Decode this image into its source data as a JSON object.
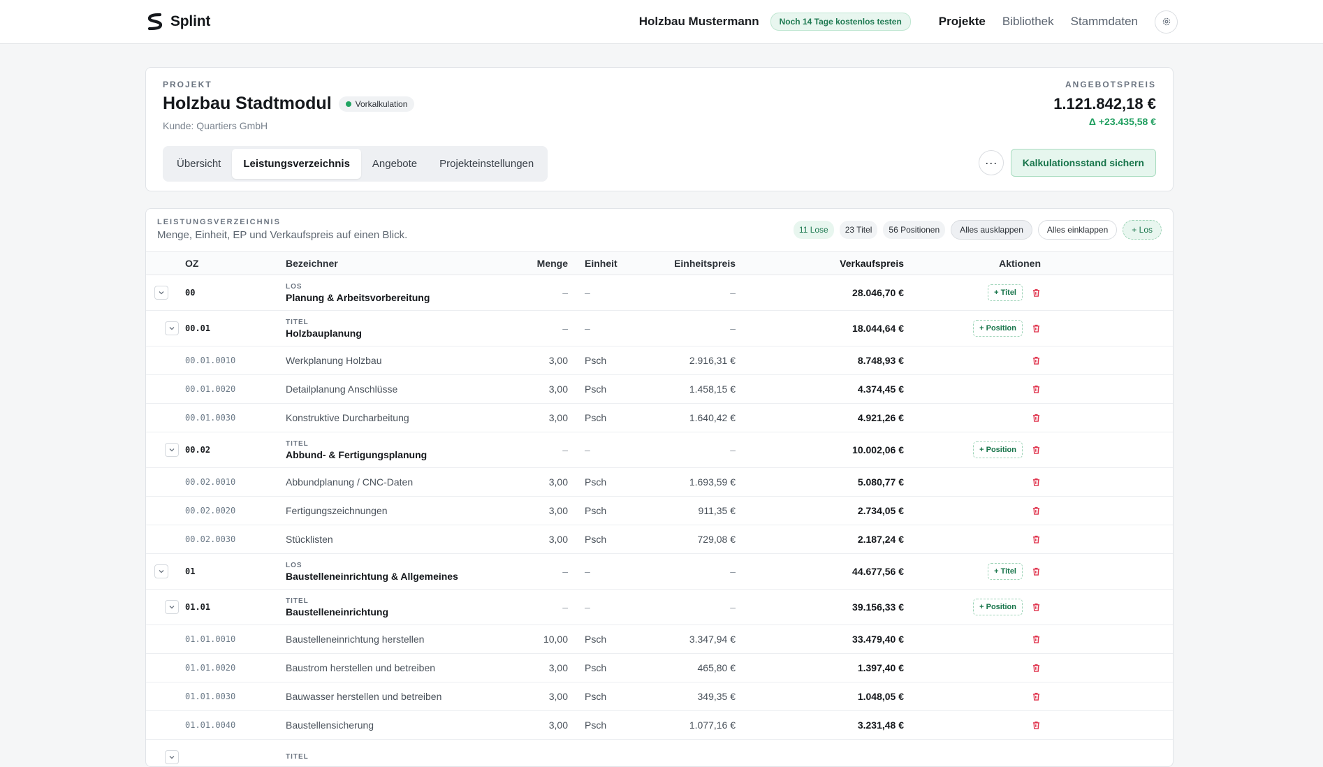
{
  "app": {
    "brand": "Splint"
  },
  "topbar": {
    "company": "Holzbau Mustermann",
    "trial": "Noch 14 Tage kostenlos testen",
    "nav": [
      "Projekte",
      "Bibliothek",
      "Stammdaten"
    ]
  },
  "project": {
    "eyebrow": "PROJEKT",
    "title": "Holzbau Stadtmodul",
    "phase": "Vorkalkulation",
    "customer": "Kunde: Quartiers GmbH",
    "tabs": [
      "Übersicht",
      "Leistungsverzeichnis",
      "Angebote",
      "Projekteinstellungen"
    ],
    "price_label": "ANGEBOTSPREIS",
    "price": "1.121.842,18 €",
    "delta": "Δ +23.435,58 €",
    "more": "···",
    "save": "Kalkulationsstand sichern"
  },
  "lv": {
    "eyebrow": "LEISTUNGSVERZEICHNIS",
    "subtitle": "Menge, Einheit, EP und Verkaufspreis auf einen Blick.",
    "chips": [
      "11 Lose",
      "23 Titel",
      "56 Positionen"
    ],
    "expand": "Alles ausklappen",
    "collapse": "Alles einklappen",
    "add_los": "+ Los",
    "columns": {
      "oz": "OZ",
      "bez": "Bezeichner",
      "menge": "Menge",
      "einheit": "Einheit",
      "ep": "Einheitspreis",
      "vk": "Verkaufspreis",
      "act": "Aktionen"
    },
    "rows": [
      {
        "type": "los",
        "kind": "LOS",
        "oz": "00",
        "name": "Planung & Arbeitsvorbereitung",
        "menge": "–",
        "einheit": "–",
        "ep": "–",
        "vk": "28.046,70 €",
        "add": "+ Titel"
      },
      {
        "type": "titel",
        "kind": "TITEL",
        "oz": "00.01",
        "name": "Holzbauplanung",
        "menge": "–",
        "einheit": "–",
        "ep": "–",
        "vk": "18.044,64 €",
        "add": "+ Position"
      },
      {
        "type": "pos",
        "oz": "00.01.0010",
        "name": "Werkplanung Holzbau",
        "menge": "3,00",
        "einheit": "Psch",
        "ep": "2.916,31 €",
        "vk": "8.748,93 €"
      },
      {
        "type": "pos",
        "oz": "00.01.0020",
        "name": "Detailplanung Anschlüsse",
        "menge": "3,00",
        "einheit": "Psch",
        "ep": "1.458,15 €",
        "vk": "4.374,45 €"
      },
      {
        "type": "pos",
        "oz": "00.01.0030",
        "name": "Konstruktive Durcharbeitung",
        "menge": "3,00",
        "einheit": "Psch",
        "ep": "1.640,42 €",
        "vk": "4.921,26 €"
      },
      {
        "type": "titel",
        "kind": "TITEL",
        "oz": "00.02",
        "name": "Abbund- & Fertigungsplanung",
        "menge": "–",
        "einheit": "–",
        "ep": "–",
        "vk": "10.002,06 €",
        "add": "+ Position"
      },
      {
        "type": "pos",
        "oz": "00.02.0010",
        "name": "Abbundplanung / CNC-Daten",
        "menge": "3,00",
        "einheit": "Psch",
        "ep": "1.693,59 €",
        "vk": "5.080,77 €"
      },
      {
        "type": "pos",
        "oz": "00.02.0020",
        "name": "Fertigungszeichnungen",
        "menge": "3,00",
        "einheit": "Psch",
        "ep": "911,35 €",
        "vk": "2.734,05 €"
      },
      {
        "type": "pos",
        "oz": "00.02.0030",
        "name": "Stücklisten",
        "menge": "3,00",
        "einheit": "Psch",
        "ep": "729,08 €",
        "vk": "2.187,24 €"
      },
      {
        "type": "los",
        "kind": "LOS",
        "oz": "01",
        "name": "Baustelleneinrichtung & Allgemeines",
        "menge": "–",
        "einheit": "–",
        "ep": "–",
        "vk": "44.677,56 €",
        "add": "+ Titel"
      },
      {
        "type": "titel",
        "kind": "TITEL",
        "oz": "01.01",
        "name": "Baustelleneinrichtung",
        "menge": "–",
        "einheit": "–",
        "ep": "–",
        "vk": "39.156,33 €",
        "add": "+ Position"
      },
      {
        "type": "pos",
        "oz": "01.01.0010",
        "name": "Baustelleneinrichtung herstellen",
        "menge": "10,00",
        "einheit": "Psch",
        "ep": "3.347,94 €",
        "vk": "33.479,40 €"
      },
      {
        "type": "pos",
        "oz": "01.01.0020",
        "name": "Baustrom herstellen und betreiben",
        "menge": "3,00",
        "einheit": "Psch",
        "ep": "465,80 €",
        "vk": "1.397,40 €"
      },
      {
        "type": "pos",
        "oz": "01.01.0030",
        "name": "Bauwasser herstellen und betreiben",
        "menge": "3,00",
        "einheit": "Psch",
        "ep": "349,35 €",
        "vk": "1.048,05 €"
      },
      {
        "type": "pos",
        "oz": "01.01.0040",
        "name": "Baustellensicherung",
        "menge": "3,00",
        "einheit": "Psch",
        "ep": "1.077,16 €",
        "vk": "3.231,48 €"
      },
      {
        "type": "titel",
        "kind": "TITEL",
        "oz": "",
        "name": "",
        "menge": "",
        "einheit": "",
        "ep": "",
        "vk": "",
        "add": ""
      }
    ]
  },
  "colors": {
    "accent": "#1f7a52",
    "danger": "#e0364f"
  }
}
